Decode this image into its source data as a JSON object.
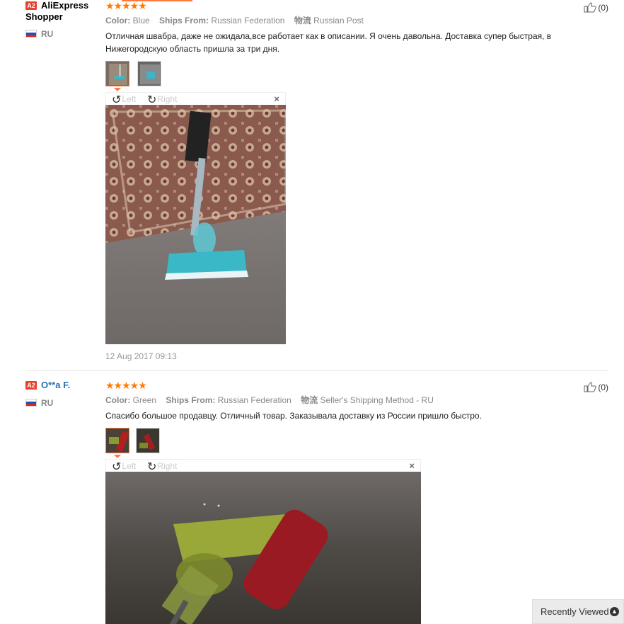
{
  "reviews": [
    {
      "level": "A2",
      "user": "AliExpress Shopper",
      "country": "RU",
      "stars": "★★★★★",
      "color_label": "Color:",
      "color_value": "Blue",
      "ships_label": "Ships From:",
      "ships_value": "Russian Federation",
      "logistics_label": "物流",
      "logistics_value": "Russian Post",
      "text": "Отличная швабра, даже не ожидала,все работает как в описании. Я очень давольна. Доставка супер быстрая, в Нижегородскую область пришла за три дня.",
      "rotate_left": "Left",
      "rotate_right": "Right",
      "close": "×",
      "date": "12 Aug 2017 09:13",
      "likes": "(0)"
    },
    {
      "level": "A2",
      "user": "O**a F.",
      "country": "RU",
      "stars": "★★★★★",
      "color_label": "Color:",
      "color_value": "Green",
      "ships_label": "Ships From:",
      "ships_value": "Russian Federation",
      "logistics_label": "物流",
      "logistics_value": "Seller's Shipping Method - RU",
      "text": "Спасибо большое продавцу. Отличный товар. Заказывала доставку из России пришло быстро.",
      "rotate_left": "Left",
      "rotate_right": "Right",
      "close": "×",
      "likes": "(0)"
    }
  ],
  "recently_viewed": "Recently Viewed",
  "colors": {
    "accent": "#ff7a3d",
    "star": "#ff7a00",
    "level_badge": "#e8412c",
    "user_link": "#2a6fb0"
  },
  "icons": [
    "thumbs-up-icon",
    "rotate-left-icon",
    "rotate-right-icon",
    "close-icon",
    "chevron-up-icon",
    "flag-ru-icon"
  ]
}
